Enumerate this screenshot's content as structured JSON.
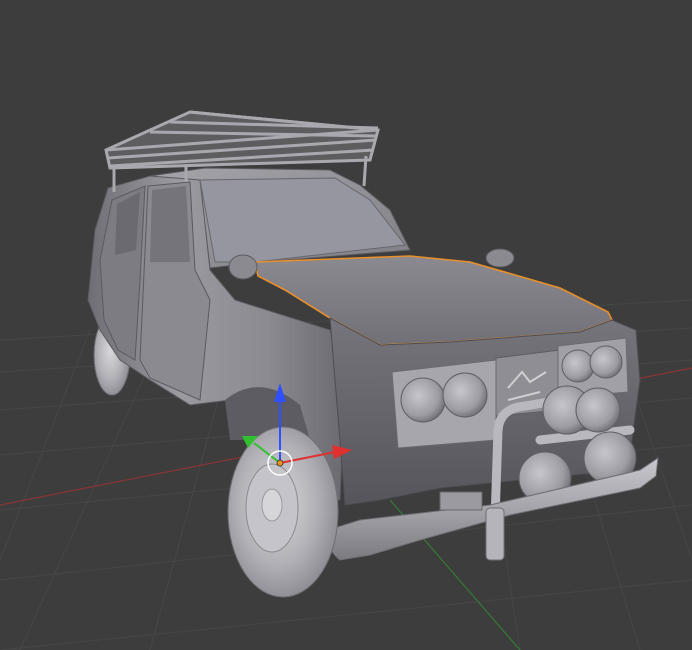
{
  "viewport": {
    "background_color": "#3d3d3d",
    "grid_color": "#4a4a4a",
    "x_axis_color": "#a33a3a",
    "y_axis_color": "#3d8f3d"
  },
  "scene": {
    "object": "rally-car-model",
    "selected_part": "hood",
    "selection_outline_color": "#e8902a",
    "model_base_color": "#8e8e94",
    "model_light_color": "#b4b4ba",
    "model_dark_color": "#5e5e64"
  },
  "gizmo": {
    "type": "translate",
    "x_arrow_color": "#e03030",
    "y_arrow_color": "#30c030",
    "z_arrow_color": "#3050ff",
    "origin_color": "#e8902a"
  }
}
